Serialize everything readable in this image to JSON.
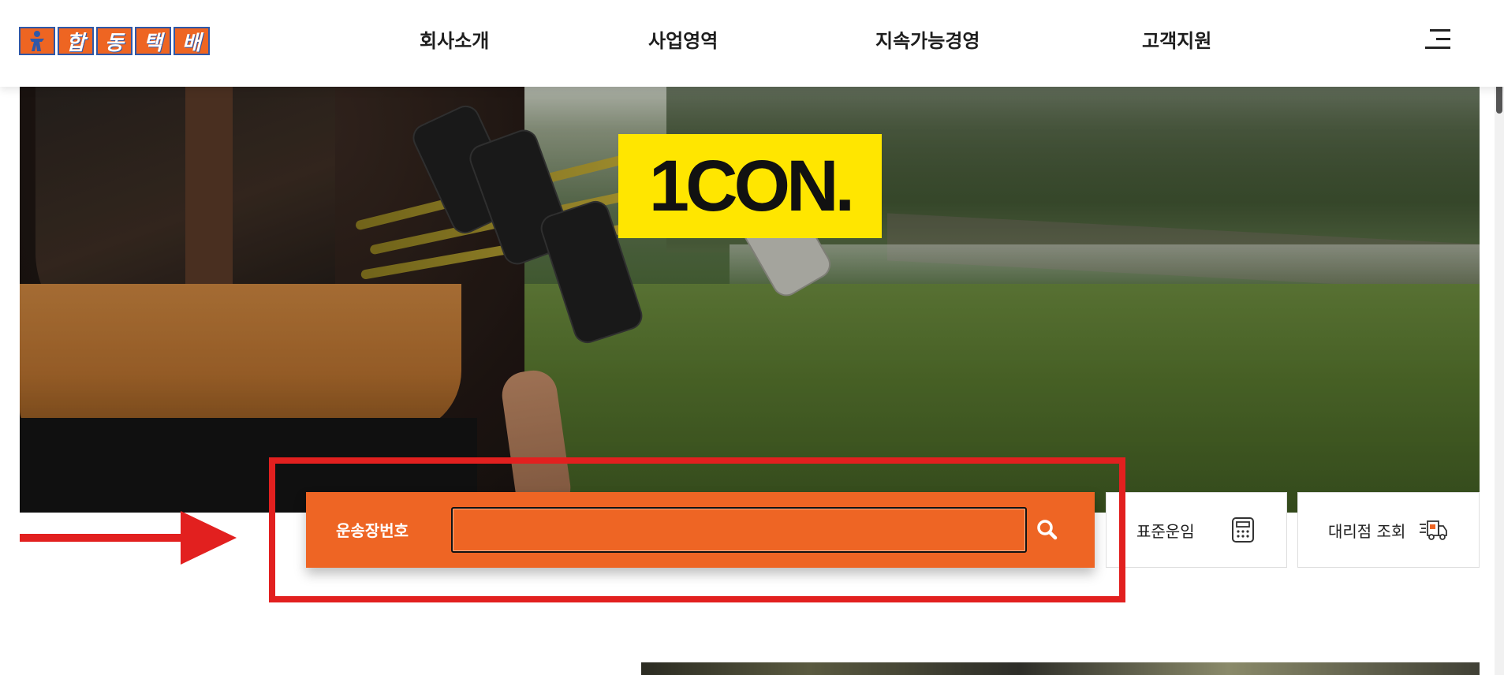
{
  "header": {
    "logo": {
      "chars": [
        "합",
        "동",
        "택",
        "배"
      ],
      "brand_color": "#ee6522",
      "border_color": "#2f58a8"
    },
    "nav": [
      {
        "label": "회사소개"
      },
      {
        "label": "사업영역"
      },
      {
        "label": "지속가능경영"
      },
      {
        "label": "고객지원"
      }
    ],
    "menu_icon": "hamburger-menu-icon"
  },
  "hero": {
    "badge_text": "1CON.",
    "badge_color": "#ffe600"
  },
  "search": {
    "label": "운송장번호",
    "value": "",
    "placeholder": "",
    "button_icon": "search-icon",
    "accent_color": "#ee6524"
  },
  "quick_links": [
    {
      "label": "표준운임",
      "icon": "calculator-icon"
    },
    {
      "label": "대리점 조회",
      "icon": "delivery-truck-icon"
    }
  ],
  "annotation": {
    "color": "#e2201f",
    "shapes": [
      "highlight-box",
      "arrow"
    ]
  }
}
